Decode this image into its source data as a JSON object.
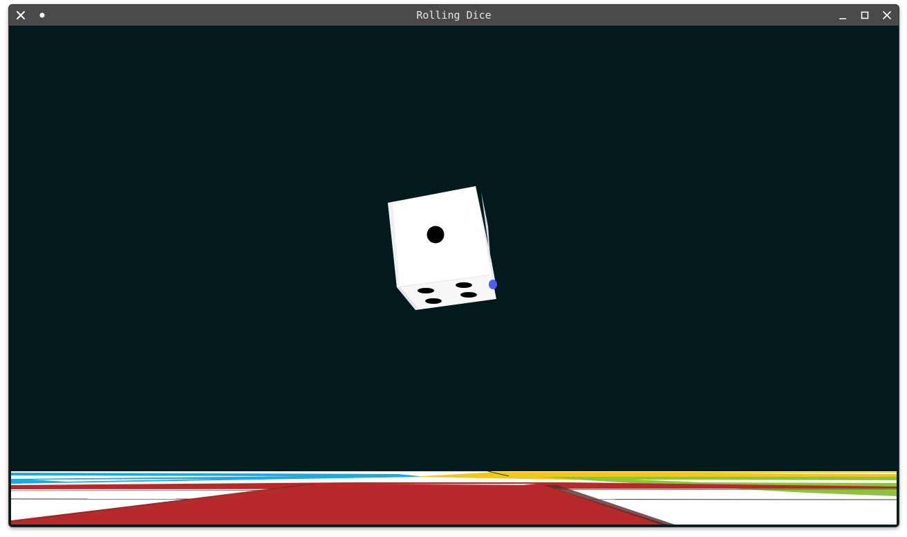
{
  "window": {
    "title": "Rolling Dice"
  },
  "titlebar": {
    "close_icon": "close-icon",
    "menu_icon": "dot-icon",
    "minimize_icon": "minimize-icon",
    "maximize_icon": "maximize-icon",
    "close_right_icon": "close-icon"
  },
  "scene": {
    "background_color": "#021a1b",
    "die": {
      "front_face_pips": 1,
      "bottom_face_pips": 4,
      "color": "#ffffff",
      "pip_color": "#000000"
    },
    "board_colors": {
      "red": "#b8292b",
      "blue": "#1aa9e0",
      "yellow": "#f5c518",
      "green": "#8cc43e",
      "white": "#ffffff"
    }
  }
}
